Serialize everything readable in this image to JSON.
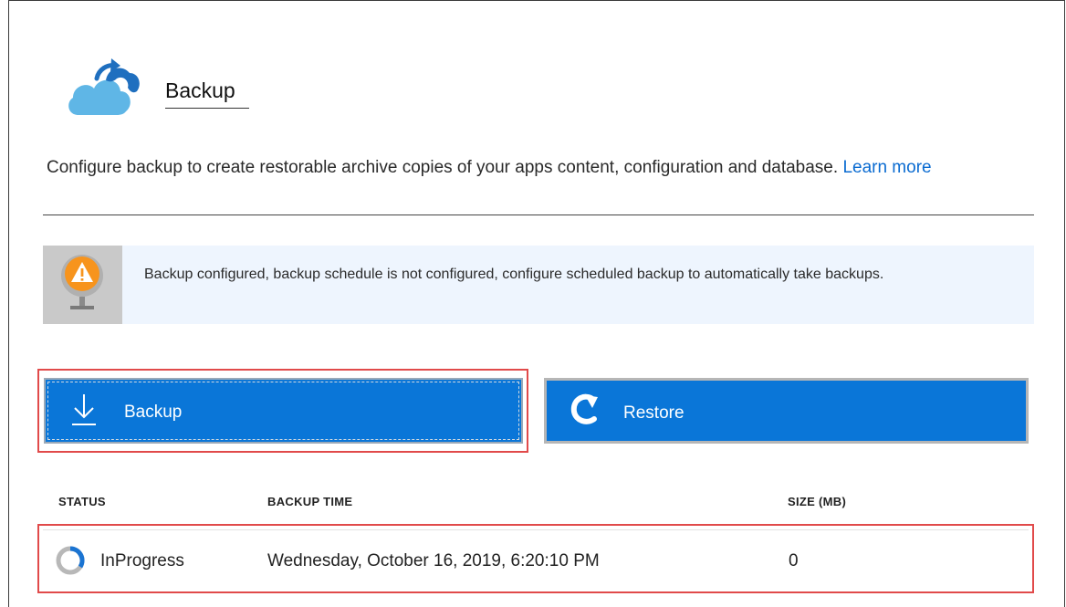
{
  "header": {
    "title": "Backup"
  },
  "description": {
    "text": "Configure backup to create restorable archive copies of your apps content, configuration and database.",
    "link": "Learn more"
  },
  "alert": {
    "icon": "warning-globe-icon",
    "text": "Backup configured, backup schedule is not configured, configure scheduled backup to automatically take backups."
  },
  "buttons": {
    "backup": {
      "label": "Backup",
      "icon": "download-arrow-icon"
    },
    "restore": {
      "label": "Restore",
      "icon": "restore-arrow-icon"
    }
  },
  "table": {
    "columns": [
      "STATUS",
      "BACKUP TIME",
      "SIZE (MB)"
    ],
    "rows": [
      {
        "status": "InProgress",
        "backup_time": "Wednesday, October 16, 2019, 6:20:10 PM",
        "size": "0"
      }
    ]
  },
  "colors": {
    "accent": "#0a76d8",
    "link": "#0a6bd1",
    "highlight": "#e14a4a",
    "alert_bg": "#eef5fe",
    "warning": "#f7941d"
  }
}
